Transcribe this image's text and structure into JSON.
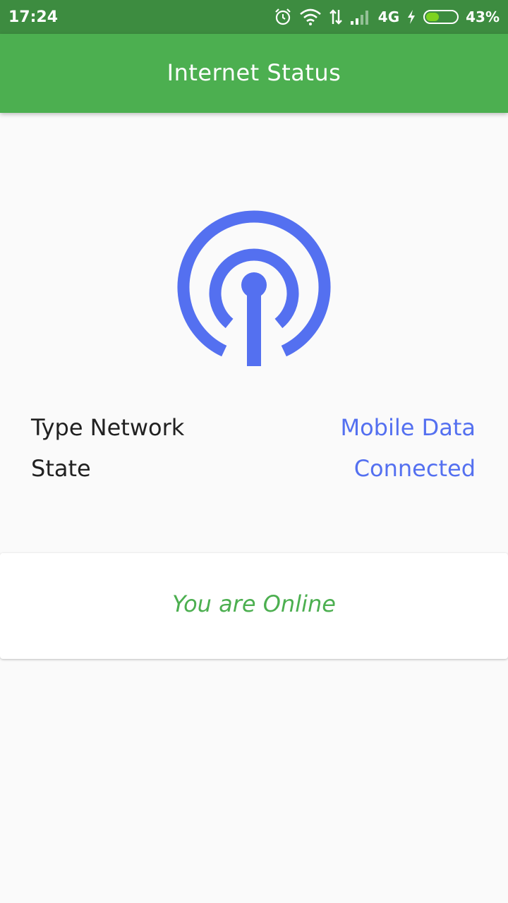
{
  "status_bar": {
    "time": "17:24",
    "network_type": "4G",
    "battery_percent": "43%",
    "battery_level": 0.43,
    "icons": [
      "alarm-icon",
      "wifi-icon",
      "data-transfer-icon",
      "signal-icon",
      "charging-icon",
      "battery-icon"
    ]
  },
  "app_bar": {
    "title": "Internet Status",
    "color": "#4caf50"
  },
  "main": {
    "icon": "broadcast-signal-icon",
    "rows": [
      {
        "label": "Type Network",
        "value": "Mobile Data"
      },
      {
        "label": "State",
        "value": "Connected"
      }
    ],
    "value_color": "#5470f0"
  },
  "status_card": {
    "message": "You are Online",
    "color": "#4caf50"
  }
}
